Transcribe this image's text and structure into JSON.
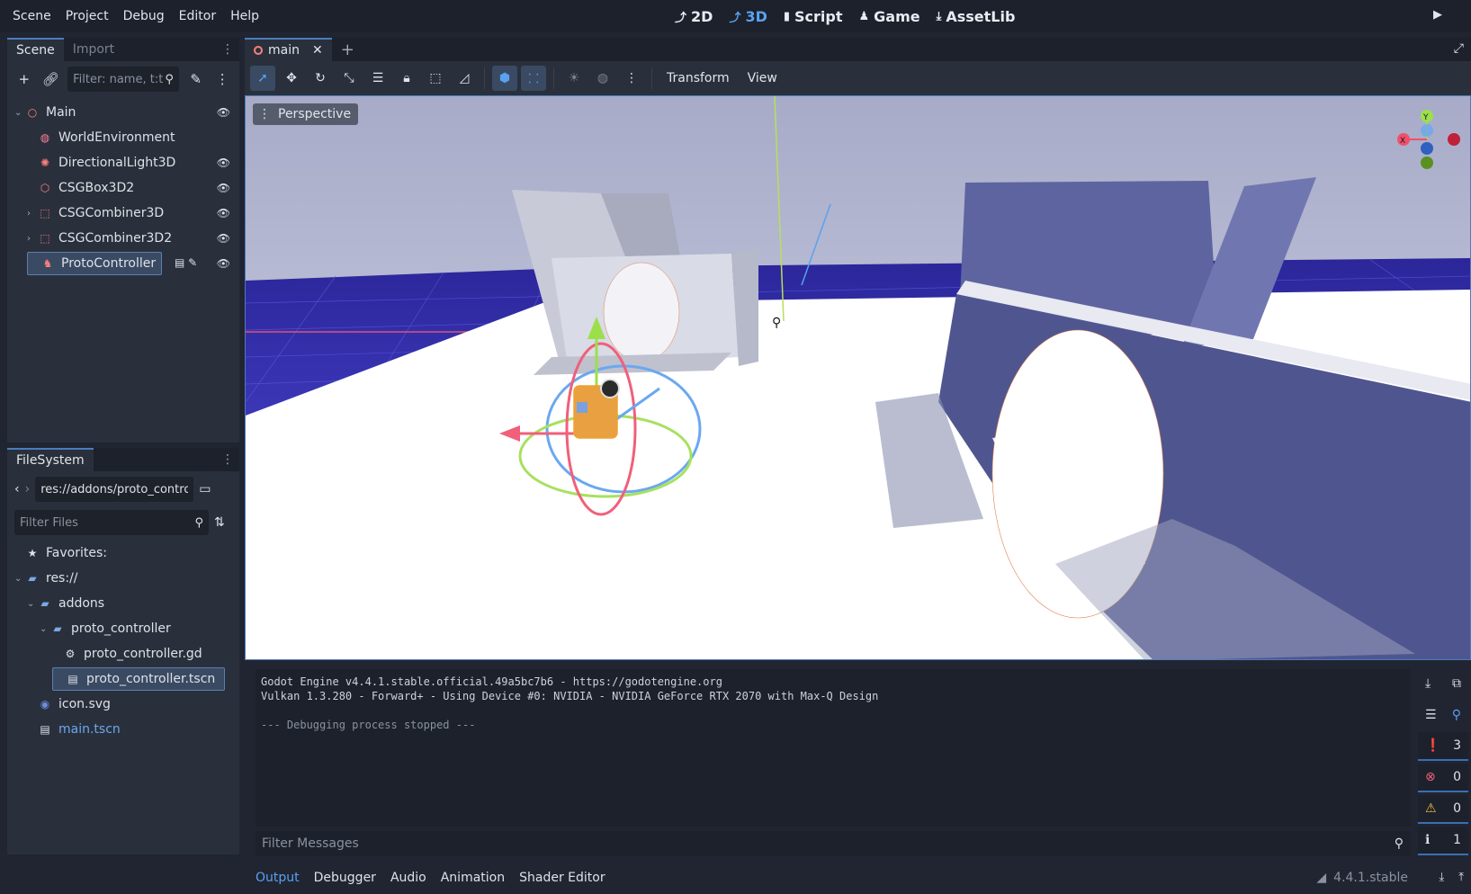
{
  "menu": [
    "Scene",
    "Project",
    "Debug",
    "Editor",
    "Help"
  ],
  "workspaces": [
    {
      "icon": "2d-icon",
      "label": "2D",
      "active": false
    },
    {
      "icon": "3d-icon",
      "label": "3D",
      "active": true
    },
    {
      "icon": "script-icon",
      "label": "Script",
      "active": false
    },
    {
      "icon": "game-icon",
      "label": "Game",
      "active": false
    },
    {
      "icon": "assetlib-icon",
      "label": "AssetLib",
      "active": false
    }
  ],
  "scene_dock": {
    "tabs": [
      "Scene",
      "Import"
    ],
    "filter_placeholder": "Filter: name, t:t",
    "nodes": [
      {
        "label": "Main",
        "icon": "node3d-icon",
        "depth": 0,
        "expander": "v",
        "eye": true
      },
      {
        "label": "WorldEnvironment",
        "icon": "world-environment-icon",
        "depth": 1,
        "expander": "",
        "eye": false
      },
      {
        "label": "DirectionalLight3D",
        "icon": "directional-light-icon",
        "depth": 1,
        "expander": "",
        "eye": true
      },
      {
        "label": "CSGBox3D2",
        "icon": "csg-box-icon",
        "depth": 1,
        "expander": "",
        "eye": true
      },
      {
        "label": "CSGCombiner3D",
        "icon": "csg-combiner-icon",
        "depth": 1,
        "expander": ">",
        "eye": true
      },
      {
        "label": "CSGCombiner3D2",
        "icon": "csg-combiner-icon",
        "depth": 1,
        "expander": ">",
        "eye": true
      },
      {
        "label": "ProtoController",
        "icon": "character-body-icon",
        "depth": 1,
        "expander": "",
        "eye": true,
        "selected": true
      }
    ]
  },
  "filesystem": {
    "tab": "FileSystem",
    "path": "res://addons/proto_contro",
    "filter_placeholder": "Filter Files",
    "items": [
      {
        "label": "Favorites:",
        "icon": "star-icon",
        "depth": 0
      },
      {
        "label": "res://",
        "icon": "folder-icon",
        "depth": 0,
        "expander": "v"
      },
      {
        "label": "addons",
        "icon": "folder-icon",
        "depth": 1,
        "expander": "v"
      },
      {
        "label": "proto_controller",
        "icon": "folder-icon",
        "depth": 2,
        "expander": "v"
      },
      {
        "label": "proto_controller.gd",
        "icon": "gear-icon",
        "depth": 3
      },
      {
        "label": "proto_controller.tscn",
        "icon": "scene-file-icon",
        "depth": 3,
        "selected": true
      },
      {
        "label": "icon.svg",
        "icon": "image-icon",
        "depth": 1
      },
      {
        "label": "main.tscn",
        "icon": "scene-file-icon",
        "depth": 1,
        "link": true
      }
    ]
  },
  "scene_tab": {
    "label": "main"
  },
  "viewport_toolbar": {
    "transform_label": "Transform",
    "view_label": "View"
  },
  "viewport": {
    "perspective_label": "Perspective"
  },
  "output": {
    "lines": [
      "Godot Engine v4.4.1.stable.official.49a5bc7b6 - https://godotengine.org",
      "Vulkan 1.3.280 - Forward+ - Using Device #0: NVIDIA - NVIDIA GeForce RTX 2070 with Max-Q Design",
      "",
      "--- Debugging process stopped ---"
    ],
    "filter_placeholder": "Filter Messages",
    "counts": {
      "messages": "3",
      "errors": "0",
      "warnings": "0",
      "info": "1"
    }
  },
  "bottom_tabs": [
    "Output",
    "Debugger",
    "Audio",
    "Animation",
    "Shader Editor"
  ],
  "version": "4.4.1.stable",
  "colors": {
    "accent": "#5aa1f0",
    "bg": "#202531",
    "panel": "#2a303b"
  }
}
